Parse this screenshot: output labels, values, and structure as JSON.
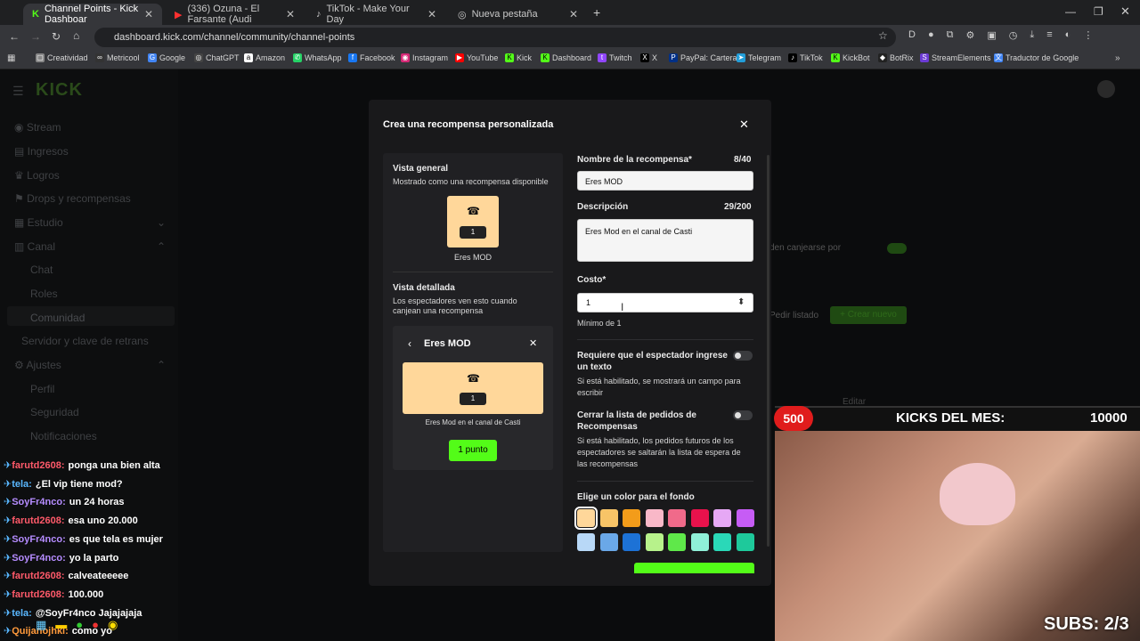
{
  "browser": {
    "tabs": [
      {
        "label": "Channel Points - Kick Dashboar"
      },
      {
        "label": "(336) Ozuna - El Farsante (Audi"
      },
      {
        "label": "TikTok - Make Your Day"
      },
      {
        "label": "Nueva pestaña"
      }
    ],
    "url": "dashboard.kick.com/channel/community/channel-points",
    "bookmarks": [
      "Creatividad",
      "Metricool",
      "Google",
      "ChatGPT",
      "Amazon",
      "WhatsApp",
      "Facebook",
      "Instagram",
      "YouTube",
      "Kick",
      "Dashboard",
      "Twitch",
      "X",
      "PayPal: Cartera",
      "Telegram",
      "TikTok",
      "KickBot",
      "BotRix",
      "StreamElements",
      "Traductor de Google"
    ]
  },
  "sidebar": {
    "stream": "Stream",
    "ingresos": "Ingresos",
    "logros": "Logros",
    "drops": "Drops y recompensas",
    "estudio": "Estudio",
    "canal": "Canal",
    "chat": "Chat",
    "roles": "Roles",
    "comunidad": "Comunidad",
    "servidor": "Servidor y clave de retrans",
    "ajustes": "Ajustes",
    "perfil": "Perfil",
    "seguridad": "Seguridad",
    "notificaciones": "Notificaciones"
  },
  "bg": {
    "canjearse": "den canjearse por",
    "pedir": "Pedir listado",
    "crear": "+ Crear nuevo",
    "editar": "Editar"
  },
  "modal": {
    "title": "Crea una recompensa personalizada",
    "overview": {
      "title": "Vista general",
      "subtitle": "Mostrado como una recompensa disponible",
      "card_count": "1",
      "card_name": "Eres MOD"
    },
    "detailed": {
      "title": "Vista detallada",
      "subtitle": "Los espectadores ven esto cuando canjean una recompensa",
      "header": "Eres MOD",
      "count": "1",
      "desc": "Eres Mod en el canal de Casti",
      "button": "1 punto"
    },
    "name_label": "Nombre de la recompensa*",
    "name_count": "8/40",
    "name_value": "Eres MOD",
    "desc_label": "Descripción",
    "desc_count": "29/200",
    "desc_value": "Eres Mod en el canal de Casti",
    "cost_label": "Costo*",
    "cost_value": "1",
    "cost_min": "Mínimo de 1",
    "req_label": "Requiere que el espectador ingrese un texto",
    "req_help": "Si está habilitado, se mostrará un campo para escribir",
    "close_label": "Cerrar la lista de pedidos de Recompensas",
    "close_help": "Si está habilitado, los pedidos futuros de los espectadores se saltarán la lista de espera de las recompensas",
    "color_label": "Elige un color para el fondo",
    "colors": [
      "#ffd79a",
      "#f8c467",
      "#f39c1a",
      "#f9b8c8",
      "#f06a8a",
      "#e8124c",
      "#e6a8f5",
      "#c65cf5",
      "#b8d8f7",
      "#6aa8e8",
      "#1d72d6",
      "#b7f28b",
      "#5fe84a",
      "#8ff0d8",
      "#2ad8b8",
      "#1ec99b"
    ]
  },
  "chat": [
    {
      "user": "farutd2608:",
      "msg": "ponga una bien alta",
      "color": "#ff5a6a"
    },
    {
      "user": "tela:",
      "msg": "¿El vip tiene mod?",
      "color": "#59b7ff"
    },
    {
      "user": "SoyFr4nco:",
      "msg": "un 24 horas",
      "color": "#b58cff"
    },
    {
      "user": "farutd2608:",
      "msg": "esa uno 20.000",
      "color": "#ff5a6a"
    },
    {
      "user": "SoyFr4nco:",
      "msg": "es que tela es mujer",
      "color": "#b58cff"
    },
    {
      "user": "SoyFr4nco:",
      "msg": "yo la parto",
      "color": "#b58cff"
    },
    {
      "user": "farutd2608:",
      "msg": "calveateeeee",
      "color": "#ff5a6a"
    },
    {
      "user": "farutd2608:",
      "msg": "100.000",
      "color": "#ff5a6a"
    },
    {
      "user": "tela:",
      "msg": "@SoyFr4nco Jajajajaja",
      "color": "#59b7ff"
    },
    {
      "user": "Quijanojhkl:",
      "msg": "como yo",
      "color": "#ff9a3c"
    }
  ],
  "stream_overlay": {
    "badge": "500",
    "kicks_label": "KICKS DEL MES:",
    "kicks_value": "10000",
    "subs": "SUBS: 2/3"
  }
}
